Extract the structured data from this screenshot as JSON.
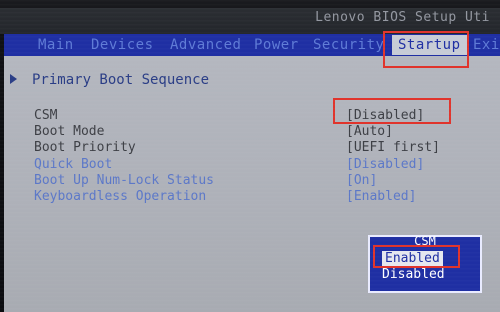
{
  "header": {
    "title": "Lenovo BIOS Setup Uti"
  },
  "menu": {
    "items": [
      {
        "label": "Main"
      },
      {
        "label": "Devices"
      },
      {
        "label": "Advanced"
      },
      {
        "label": "Power"
      },
      {
        "label": "Security"
      },
      {
        "label": "Startup"
      },
      {
        "label": "Exit"
      }
    ],
    "active": "Startup"
  },
  "section": {
    "title": "Primary Boot Sequence"
  },
  "settings": {
    "rows": [
      {
        "label": "CSM",
        "value": "[Disabled]",
        "state": "enabled"
      },
      {
        "label": "Boot Mode",
        "value": "[Auto]",
        "state": "enabled"
      },
      {
        "label": "Boot Priority",
        "value": "[UEFI first]",
        "state": "enabled"
      },
      {
        "label": "Quick Boot",
        "value": "[Disabled]",
        "state": "muted"
      },
      {
        "label": "Boot Up Num-Lock Status",
        "value": "[On]",
        "state": "muted"
      },
      {
        "label": "Keyboardless Operation",
        "value": "[Enabled]",
        "state": "muted"
      }
    ]
  },
  "popup": {
    "title": "CSM",
    "options": [
      {
        "label": "Enabled",
        "selected": true
      },
      {
        "label": "Disabled",
        "selected": false
      }
    ]
  },
  "colors": {
    "menu_bar": "#1f2fa3",
    "panel": "#b4b7bf",
    "annotation": "#e0342c"
  },
  "icons": {
    "section_marker": "right-triangle-icon"
  }
}
